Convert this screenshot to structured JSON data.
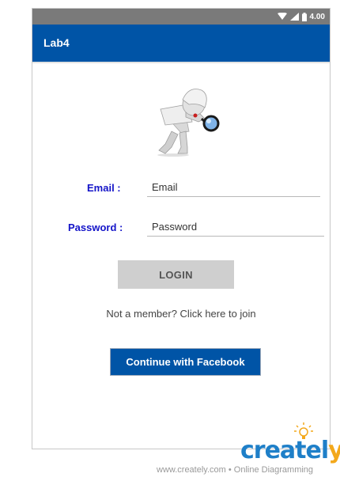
{
  "status_bar": {
    "time": "4.00"
  },
  "app_bar": {
    "title": "Lab4"
  },
  "form": {
    "email_label": "Email :",
    "email_placeholder": "Email",
    "password_label": "Password :",
    "password_placeholder": "Password",
    "login_label": "LOGIN",
    "join_text": "Not a member? Click here to join",
    "facebook_label": "Continue with Facebook"
  },
  "watermark": {
    "logo_main": "createl",
    "logo_tail": "y",
    "footer": "www.creately.com • Online Diagramming"
  },
  "colors": {
    "app_bar": "#0054a6",
    "label_text": "#1414c8",
    "login_button": "#cfcfcf",
    "facebook_button": "#0054a6"
  }
}
